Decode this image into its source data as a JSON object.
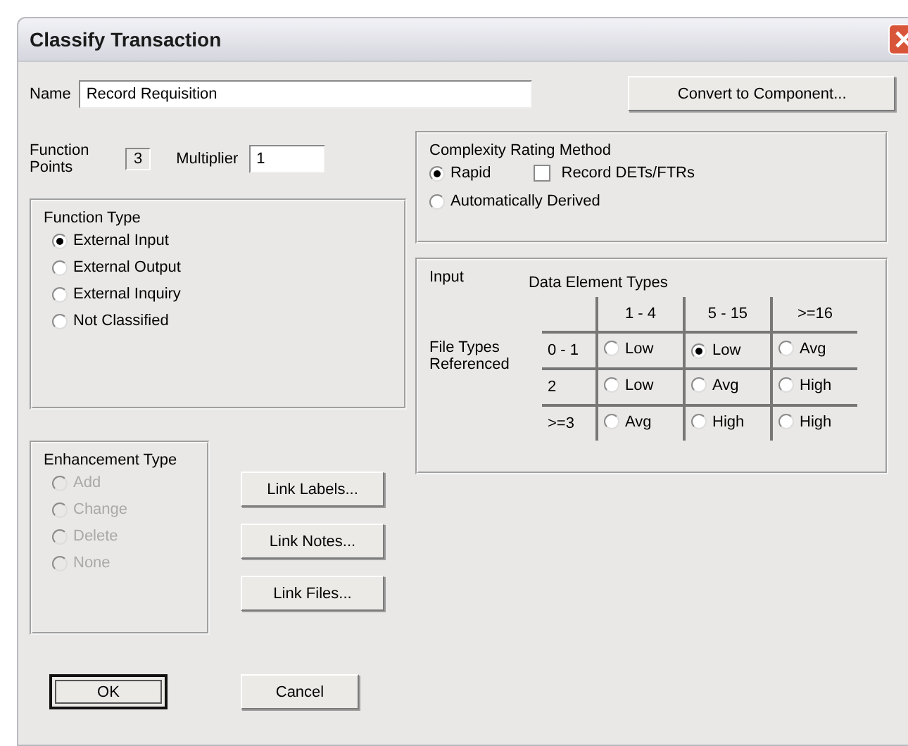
{
  "window": {
    "title": "Classify Transaction"
  },
  "name_field": {
    "label": "Name",
    "value": "Record Requisition"
  },
  "convert_button": "Convert to Component...",
  "function_points": {
    "label": "Function Points",
    "value": "3"
  },
  "multiplier": {
    "label": "Multiplier",
    "value": "1"
  },
  "function_type": {
    "title": "Function Type",
    "disabled": false,
    "options": [
      {
        "label": "External Input",
        "selected": true
      },
      {
        "label": "External Output",
        "selected": false
      },
      {
        "label": "External Inquiry",
        "selected": false
      },
      {
        "label": "Not Classified",
        "selected": false
      }
    ]
  },
  "enhancement_type": {
    "title": "Enhancement Type",
    "disabled": true,
    "options": [
      {
        "label": "Add",
        "selected": false
      },
      {
        "label": "Change",
        "selected": false
      },
      {
        "label": "Delete",
        "selected": false
      },
      {
        "label": "None",
        "selected": false
      }
    ]
  },
  "link_buttons": [
    "Link Labels...",
    "Link Notes...",
    "Link Files..."
  ],
  "complexity": {
    "title": "Complexity Rating Method",
    "methods": [
      {
        "label": "Rapid",
        "selected": true
      },
      {
        "label": "Automatically Derived",
        "selected": false
      }
    ],
    "record_checkbox": {
      "label": "Record DETs/FTRs",
      "checked": false
    }
  },
  "matrix": {
    "title": "Input",
    "column_header": "Data Element Types",
    "row_header": "File Types Referenced",
    "columns": [
      "1 - 4",
      "5 - 15",
      ">=16"
    ],
    "rows": [
      {
        "label": "0 - 1",
        "cells": [
          {
            "label": "Low",
            "selected": false
          },
          {
            "label": "Low",
            "selected": true
          },
          {
            "label": "Avg",
            "selected": false
          }
        ]
      },
      {
        "label": "2",
        "cells": [
          {
            "label": "Low",
            "selected": false
          },
          {
            "label": "Avg",
            "selected": false
          },
          {
            "label": "High",
            "selected": false
          }
        ]
      },
      {
        "label": ">=3",
        "cells": [
          {
            "label": "Avg",
            "selected": false
          },
          {
            "label": "High",
            "selected": false
          },
          {
            "label": "High",
            "selected": false
          }
        ]
      }
    ]
  },
  "buttons": [
    {
      "label": "OK",
      "default": true
    },
    {
      "label": "Cancel",
      "default": false
    }
  ]
}
